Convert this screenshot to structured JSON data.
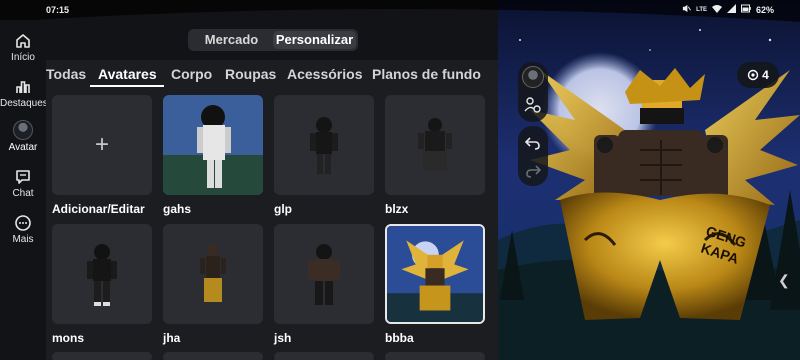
{
  "status": {
    "time": "07:15",
    "battery": "62%",
    "icons": [
      "mute-icon",
      "lte-icon",
      "wifi-icon",
      "signal-icon",
      "battery-icon"
    ]
  },
  "nav": {
    "items": [
      {
        "label": "Início",
        "icon": "home-icon"
      },
      {
        "label": "Destaques",
        "icon": "chart-icon"
      },
      {
        "label": "Avatar",
        "icon": "avatar-icon"
      },
      {
        "label": "Chat",
        "icon": "chat-icon"
      },
      {
        "label": "Mais",
        "icon": "more-icon"
      }
    ]
  },
  "segment": {
    "options": [
      "Mercado",
      "Personalizar"
    ],
    "selected": "Personalizar"
  },
  "tabs": [
    "Todas",
    "Avatares",
    "Corpo",
    "Roupas",
    "Acessórios",
    "Planos de fundo"
  ],
  "active_tab": "Avatares",
  "tiles": [
    {
      "label": "Adicionar/Editar",
      "kind": "add"
    },
    {
      "label": "gahs",
      "kind": "photo-white"
    },
    {
      "label": "glp",
      "kind": "dark"
    },
    {
      "label": "blzx",
      "kind": "dark"
    },
    {
      "label": "mons",
      "kind": "dark"
    },
    {
      "label": "jha",
      "kind": "dark-gold"
    },
    {
      "label": "jsh",
      "kind": "dark"
    },
    {
      "label": "bbba",
      "kind": "photo-gold",
      "selected": true
    }
  ],
  "right": {
    "counter": "4",
    "counter_icon": "eye-icon"
  },
  "colors": {
    "panel": "#1b1d21",
    "rail": "#121316",
    "tile": "#2b2d32",
    "sky_top": "#1a2b6a",
    "gold": "#d9a21f"
  }
}
